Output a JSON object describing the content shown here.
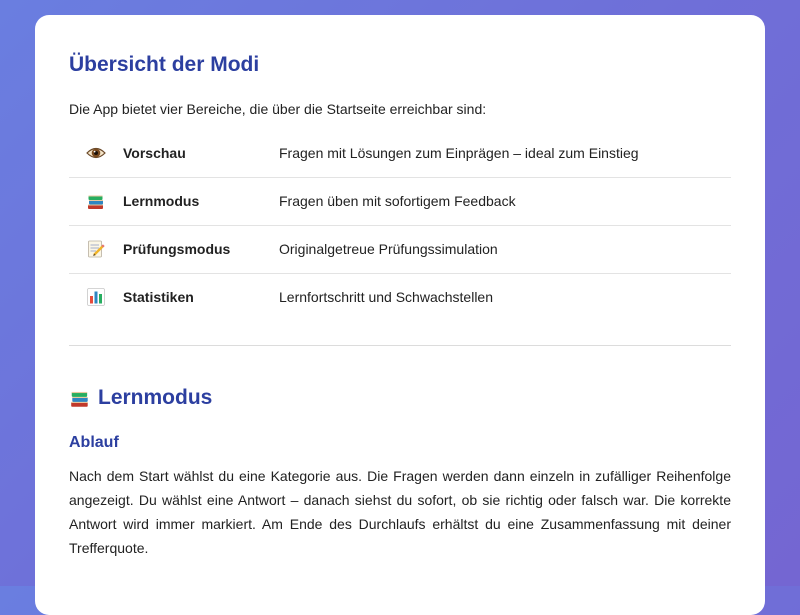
{
  "overview": {
    "title": "Übersicht der Modi",
    "intro": "Die App bietet vier Bereiche, die über die Startseite erreichbar sind:",
    "modes": [
      {
        "icon": "eye-icon",
        "name": "Vorschau",
        "description": "Fragen mit Lösungen zum Einprägen – ideal zum Einstieg"
      },
      {
        "icon": "books-icon",
        "name": "Lernmodus",
        "description": "Fragen üben mit sofortigem Feedback"
      },
      {
        "icon": "memo-icon",
        "name": "Prüfungsmodus",
        "description": "Originalgetreue Prüfungssimulation"
      },
      {
        "icon": "bar-chart-icon",
        "name": "Statistiken",
        "description": "Lernfortschritt und Schwachstellen"
      }
    ]
  },
  "lernmodus": {
    "icon": "books-icon",
    "title": "Lernmodus",
    "subtitle": "Ablauf",
    "text": "Nach dem Start wählst du eine Kategorie aus. Die Fragen werden dann einzeln in zufälliger Reihenfolge angezeigt. Du wählst eine Antwort – danach siehst du sofort, ob sie richtig oder falsch war. Die korrekte Antwort wird immer markiert. Am Ende des Durchlaufs erhältst du eine Zusammenfassung mit deiner Trefferquote."
  },
  "colors": {
    "background_gradient_start": "#6a7ee0",
    "background_gradient_end": "#7466d2",
    "heading": "#2c3fa0",
    "text": "#222222",
    "card": "#ffffff"
  }
}
